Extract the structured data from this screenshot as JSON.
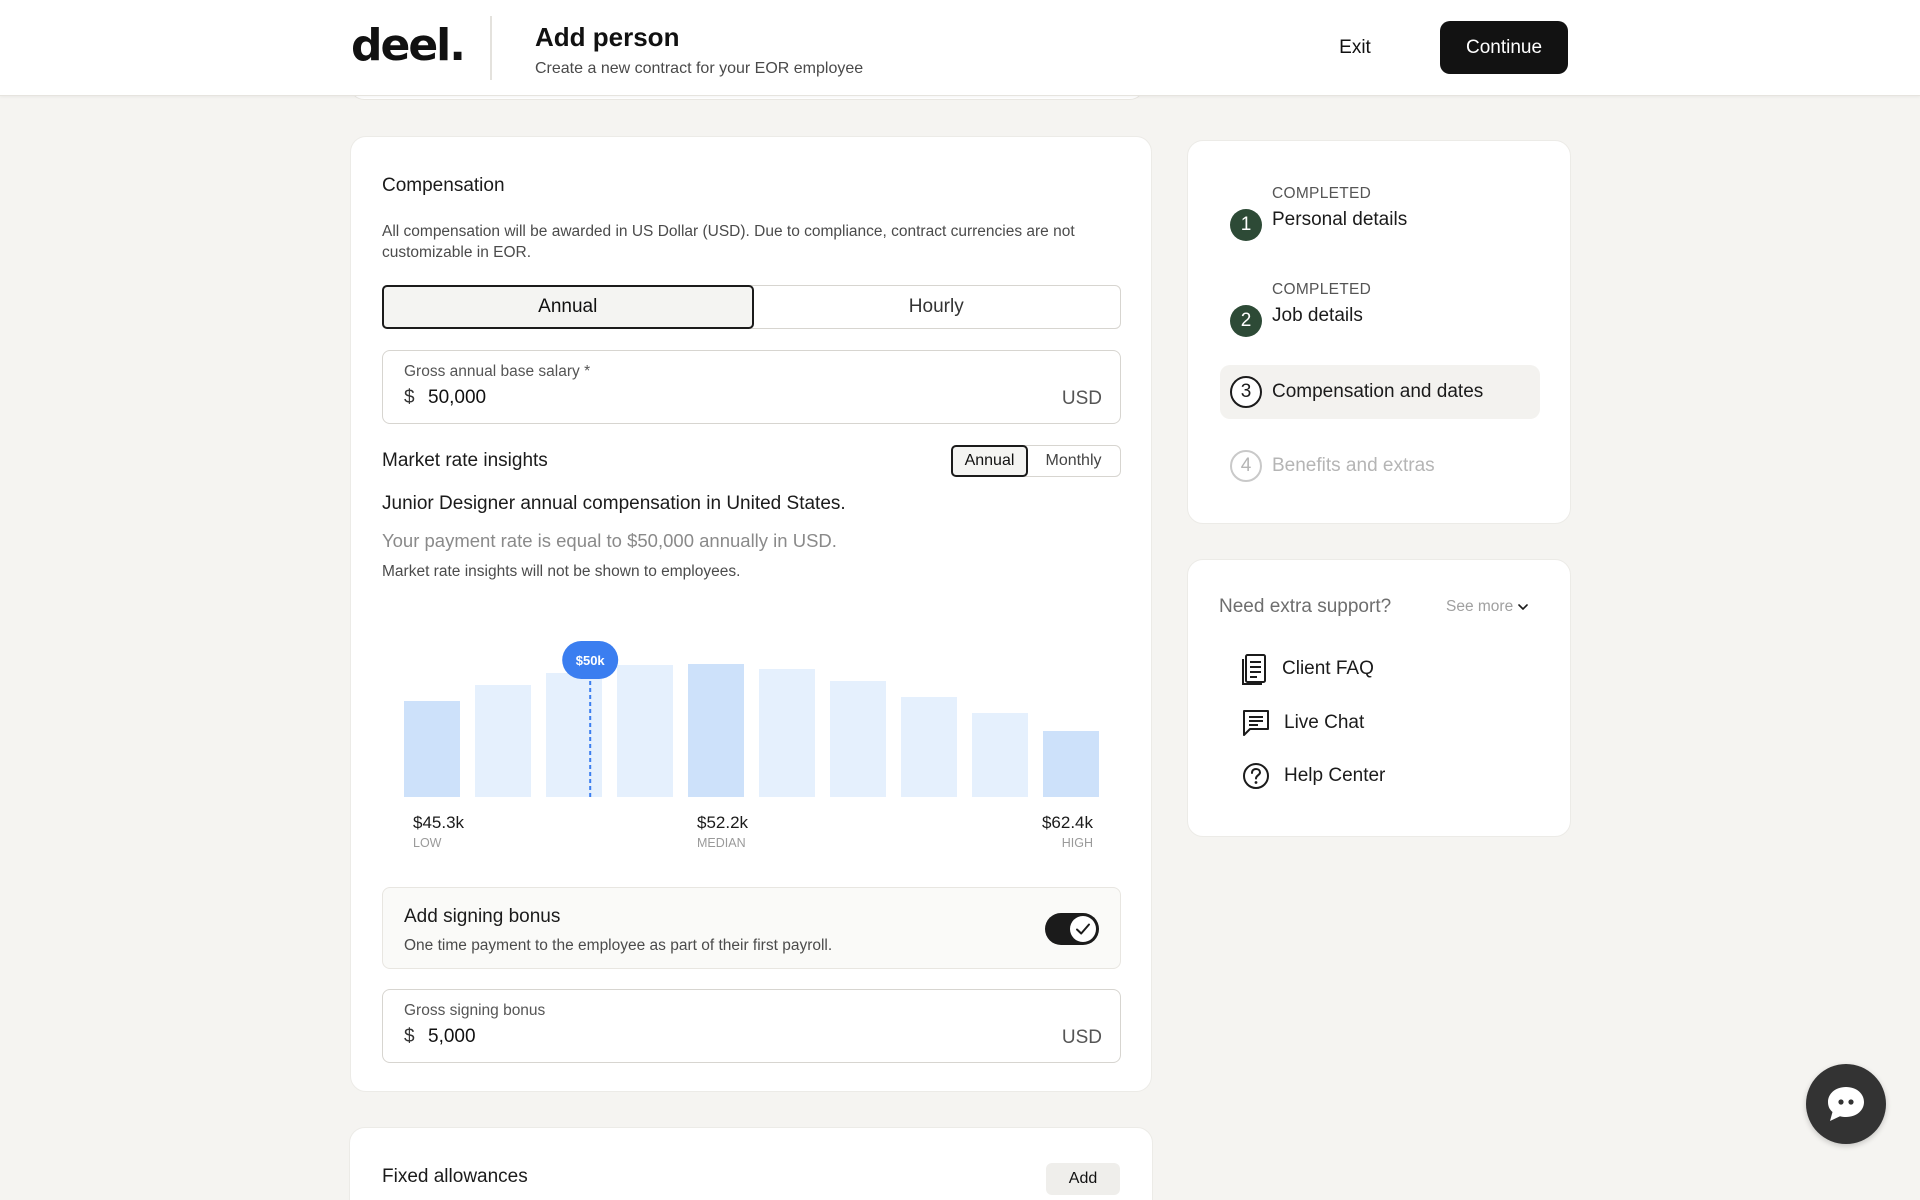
{
  "header": {
    "logo": "deel.",
    "title": "Add person",
    "subtitle": "Create a new contract for your EOR employee",
    "exit_label": "Exit",
    "continue_label": "Continue"
  },
  "compensation": {
    "title": "Compensation",
    "description": "All compensation will be awarded in US Dollar (USD). Due to compliance, contract currencies are not customizable in EOR.",
    "rate_tabs": [
      {
        "label": "Annual",
        "active": true
      },
      {
        "label": "Hourly",
        "active": false
      }
    ],
    "salary": {
      "label": "Gross annual base salary *",
      "currency_symbol": "$",
      "value": "50,000",
      "unit": "USD"
    },
    "market": {
      "title": "Market rate insights",
      "tabs": [
        {
          "label": "Annual",
          "active": true
        },
        {
          "label": "Monthly",
          "active": false
        }
      ],
      "line1": "Junior Designer annual compensation in United States.",
      "line2": "Your payment rate is equal to $50,000 annually in USD.",
      "line3": "Market rate insights will not be shown to employees."
    },
    "signing_bonus": {
      "title": "Add signing bonus",
      "subtitle": "One time payment to the employee as part of their first payroll.",
      "enabled": true
    },
    "bonus_field": {
      "label": "Gross signing bonus",
      "currency_symbol": "$",
      "value": "5,000",
      "unit": "USD"
    }
  },
  "chart_data": {
    "type": "bar",
    "values": [
      0.48,
      0.56,
      0.62,
      0.66,
      0.665,
      0.64,
      0.58,
      0.5,
      0.42,
      0.33
    ],
    "highlighted": [
      0,
      4,
      9
    ],
    "marker": {
      "label": "$50k",
      "position": 2.7
    },
    "ticks": [
      {
        "value": "$45.3k",
        "caption": "LOW",
        "bar": 0
      },
      {
        "value": "$52.2k",
        "caption": "MEDIAN",
        "bar": 4
      },
      {
        "value": "$62.4k",
        "caption": "HIGH",
        "bar": 9
      }
    ],
    "colors": {
      "highlight": "#cde1fa",
      "normal": "#e5f0fd",
      "marker": "#3b7ef0"
    }
  },
  "allowances": {
    "title": "Fixed allowances",
    "add_label": "Add"
  },
  "steps": [
    {
      "number": "1",
      "status": "COMPLETED",
      "label": "Personal details",
      "state": "done"
    },
    {
      "number": "2",
      "status": "COMPLETED",
      "label": "Job details",
      "state": "done"
    },
    {
      "number": "3",
      "status": "",
      "label": "Compensation and dates",
      "state": "current"
    },
    {
      "number": "4",
      "status": "",
      "label": "Benefits and extras",
      "state": "future"
    }
  ],
  "support": {
    "title": "Need extra support?",
    "see_more": "See more",
    "items": [
      {
        "label": "Client FAQ",
        "icon": "document-icon"
      },
      {
        "label": "Live Chat",
        "icon": "chat-icon"
      },
      {
        "label": "Help Center",
        "icon": "question-icon"
      }
    ]
  },
  "colors": {
    "brand_dark": "#121212",
    "step_done": "#2d4a36",
    "accent_blue": "#3b7ef0"
  }
}
